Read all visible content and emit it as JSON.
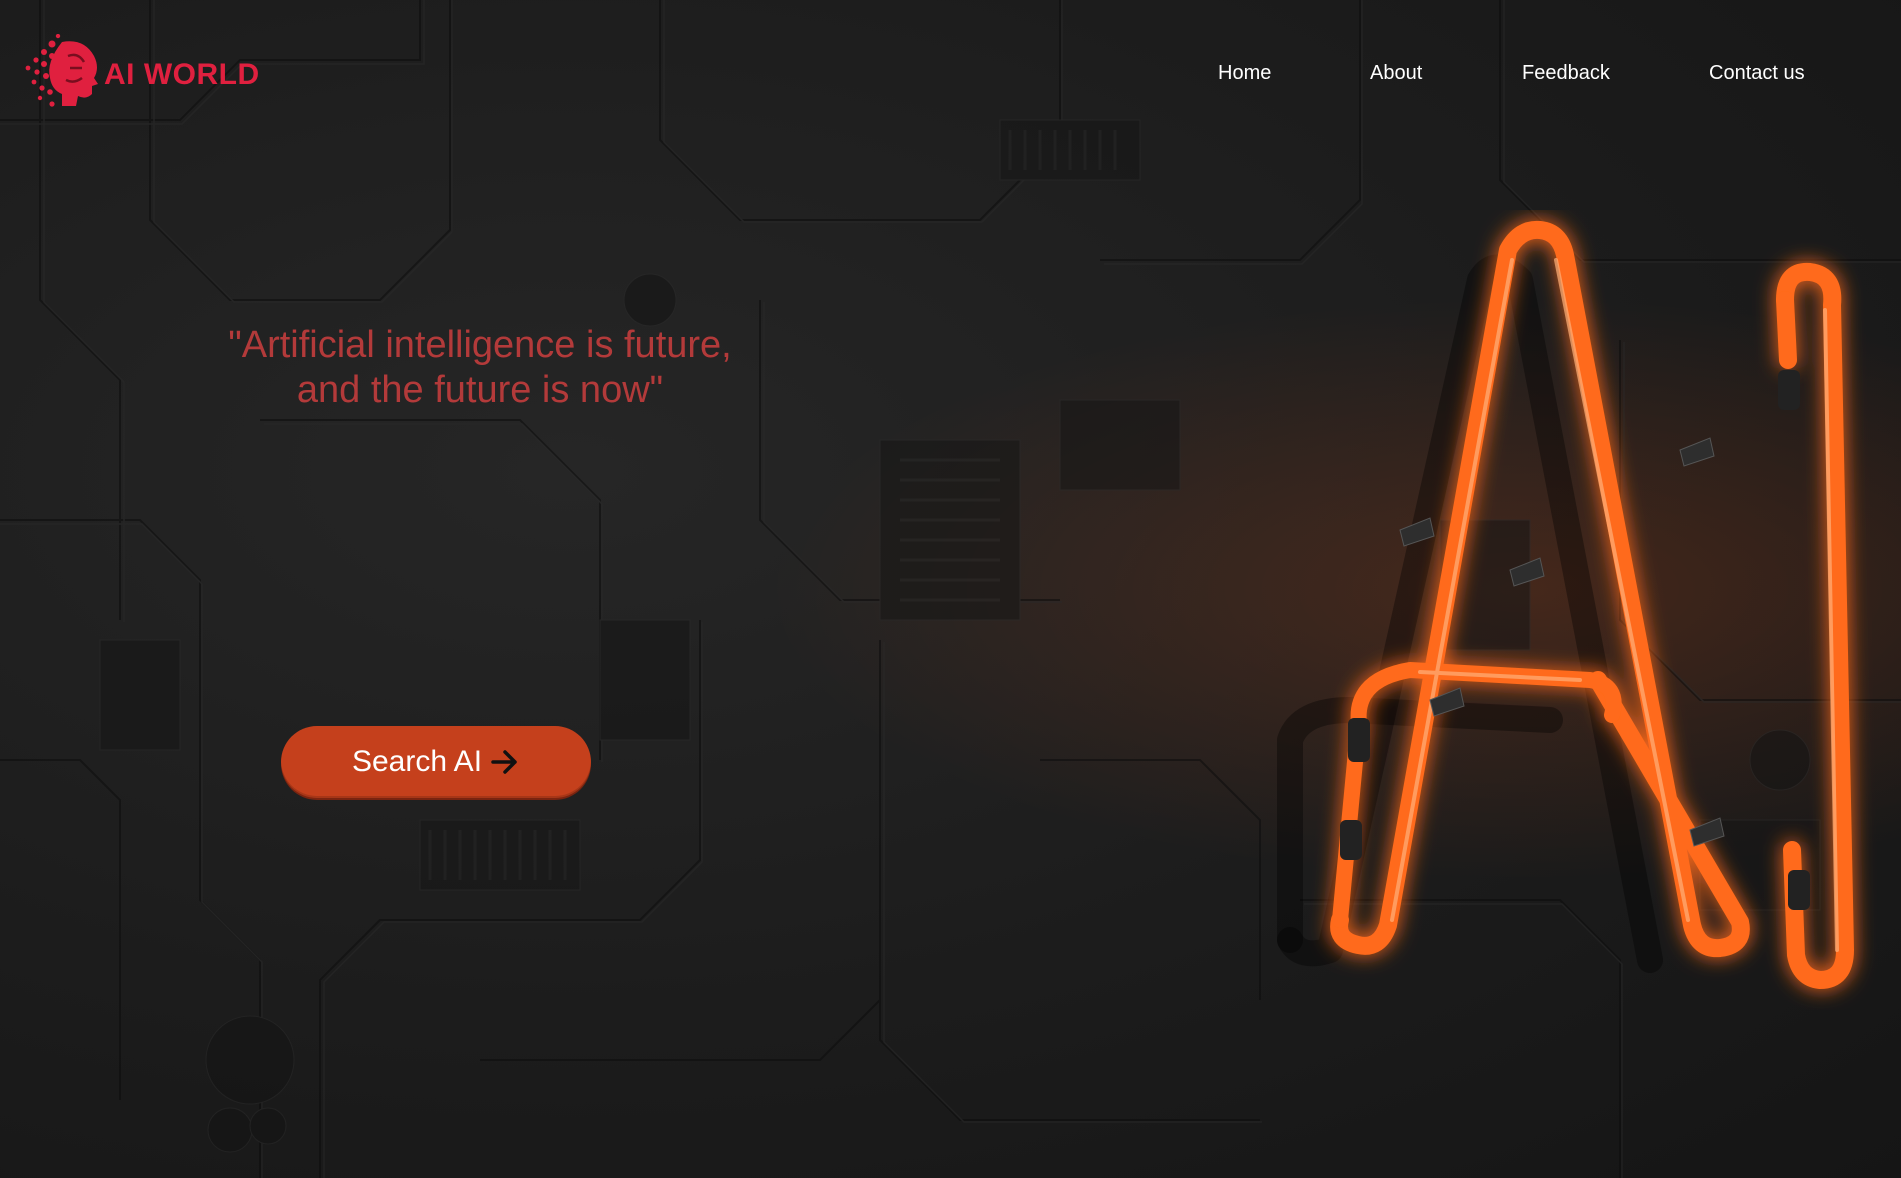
{
  "brand": {
    "name": "AI WORLD",
    "color": "#e0203f",
    "logo_icon": "brain-circuit-icon"
  },
  "nav": {
    "items": [
      {
        "label": "Home"
      },
      {
        "label": "About"
      },
      {
        "label": "Feedback"
      },
      {
        "label": "Contact us"
      }
    ]
  },
  "hero": {
    "quote_line1": "\"Artificial intelligence is future,",
    "quote_line2": "and the future is now\"",
    "quote_color": "#b33a3a",
    "cta_label": "Search AI",
    "cta_icon": "arrow-right-icon",
    "cta_color": "#c5401c"
  },
  "art": {
    "neon_icon": "neon-ai-sign",
    "neon_color": "#ff6a1a"
  }
}
